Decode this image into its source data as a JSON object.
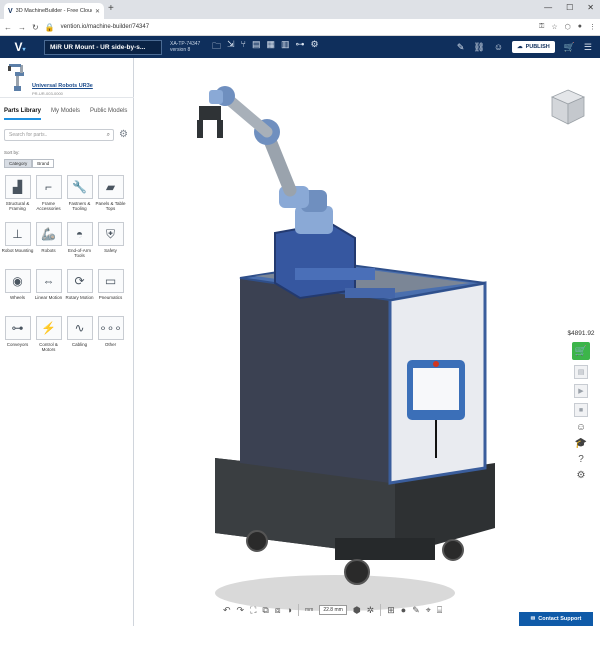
{
  "browser": {
    "tab_title": "3D MachineBuilder - Free Cloud",
    "tab_logo": "V",
    "url": "vention.io/machine-builder/74347"
  },
  "header": {
    "project_name": "MiR UR Mount - UR side-by-s...",
    "project_id": "XA-TP-74347",
    "version": "version 8",
    "publish_label": "PUBLISH"
  },
  "component": {
    "name": "Universal Robots UR3e",
    "sku": "PR-UR-003-0000"
  },
  "library": {
    "tabs": [
      "Parts Library",
      "My Models",
      "Public Models"
    ],
    "search_placeholder": "Search for parts..",
    "sort_label": "Sort by:",
    "sort_options": [
      "Category",
      "Brand"
    ],
    "categories": [
      {
        "label": "Structural & Framing",
        "icon": "frame-icon"
      },
      {
        "label": "Frame Accessories",
        "icon": "bracket-icon"
      },
      {
        "label": "Fastners & Tooling",
        "icon": "wrench-icon"
      },
      {
        "label": "Panels & Table Tops",
        "icon": "panel-icon"
      },
      {
        "label": "Robot Mounting",
        "icon": "mount-icon"
      },
      {
        "label": "Robots",
        "icon": "robot-icon"
      },
      {
        "label": "End-of-Arm Tools",
        "icon": "gripper-icon"
      },
      {
        "label": "Safety",
        "icon": "safety-icon"
      },
      {
        "label": "Wheels",
        "icon": "wheel-icon"
      },
      {
        "label": "Linear Motion",
        "icon": "linear-icon"
      },
      {
        "label": "Rotary Motion",
        "icon": "rotary-icon"
      },
      {
        "label": "Pneumatics",
        "icon": "pneumatic-icon"
      },
      {
        "label": "Conveyors",
        "icon": "conveyor-icon"
      },
      {
        "label": "Control & Motors",
        "icon": "motor-icon"
      },
      {
        "label": "Cabling",
        "icon": "cable-icon"
      },
      {
        "label": "Other",
        "icon": "other-icon"
      }
    ]
  },
  "viewcube": {
    "face": "Front"
  },
  "rail": {
    "price": "$4891.92"
  },
  "bottombar": {
    "mm_value": "22.8 mm",
    "unit": "mm"
  },
  "contact_label": "Contact Support",
  "colors": {
    "header": "#0f2f5c",
    "accent": "#1d8fe0",
    "cart": "#3cb54a"
  }
}
